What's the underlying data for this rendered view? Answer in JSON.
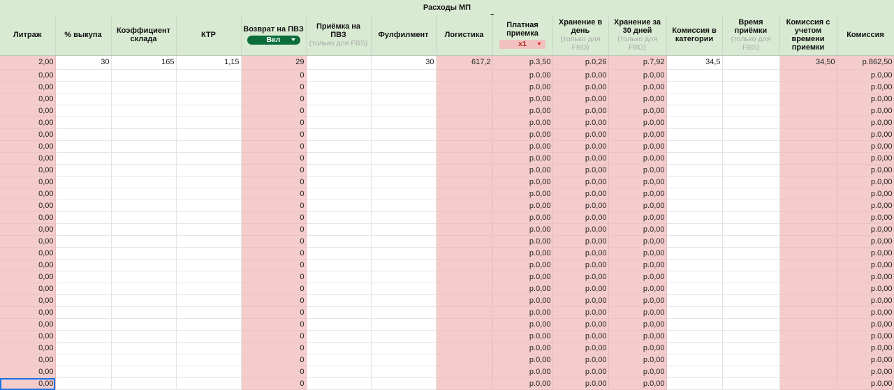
{
  "sheet": {
    "group_title": "Расходы МП",
    "headers": [
      {
        "label": "Литраж",
        "sub": ""
      },
      {
        "label": "% выкупа",
        "sub": ""
      },
      {
        "label": "Коэффициент склада",
        "sub": ""
      },
      {
        "label": "КТР",
        "sub": ""
      },
      {
        "label": "Возврат на ПВЗ",
        "sub": "",
        "control": "Вкл"
      },
      {
        "label": "Приёмка на ПВЗ",
        "sub": "(только для FBS)"
      },
      {
        "label": "Фулфилмент",
        "sub": ""
      },
      {
        "label": "Логистика",
        "sub": ""
      },
      {
        "label": "Платная приемка",
        "sub": "",
        "control": "x1"
      },
      {
        "label": "Хранение в день",
        "sub": "(только для FBO)"
      },
      {
        "label": "Хранение за 30 дней",
        "sub": "(только для FBO)"
      },
      {
        "label": "Комиссия в категории",
        "sub": ""
      },
      {
        "label": "Время приёмки",
        "sub": "(только для FBS)"
      },
      {
        "label": "Комиссия с учетом времени приемки",
        "sub": ""
      },
      {
        "label": "Комиссия",
        "sub": ""
      }
    ],
    "first_row": [
      "2,00",
      "30",
      "165",
      "1,15",
      "29",
      "",
      "30",
      "617,2",
      "р.3,50",
      "р.0,26",
      "р.7,92",
      "34,5",
      "",
      "34,50",
      "р.862,50"
    ],
    "repeat_row": [
      "0,00",
      "",
      "",
      "",
      "0",
      "",
      "",
      "",
      "р.0,00",
      "р.0,00",
      "р.0,00",
      "",
      "",
      "",
      "р.0,00"
    ],
    "repeat_count": 27,
    "colors": {
      "header_bg": "#d9ead3",
      "pink": "#f4cccc",
      "toggle_green": "#0b6e3a",
      "chip_red": "#d93025"
    }
  }
}
